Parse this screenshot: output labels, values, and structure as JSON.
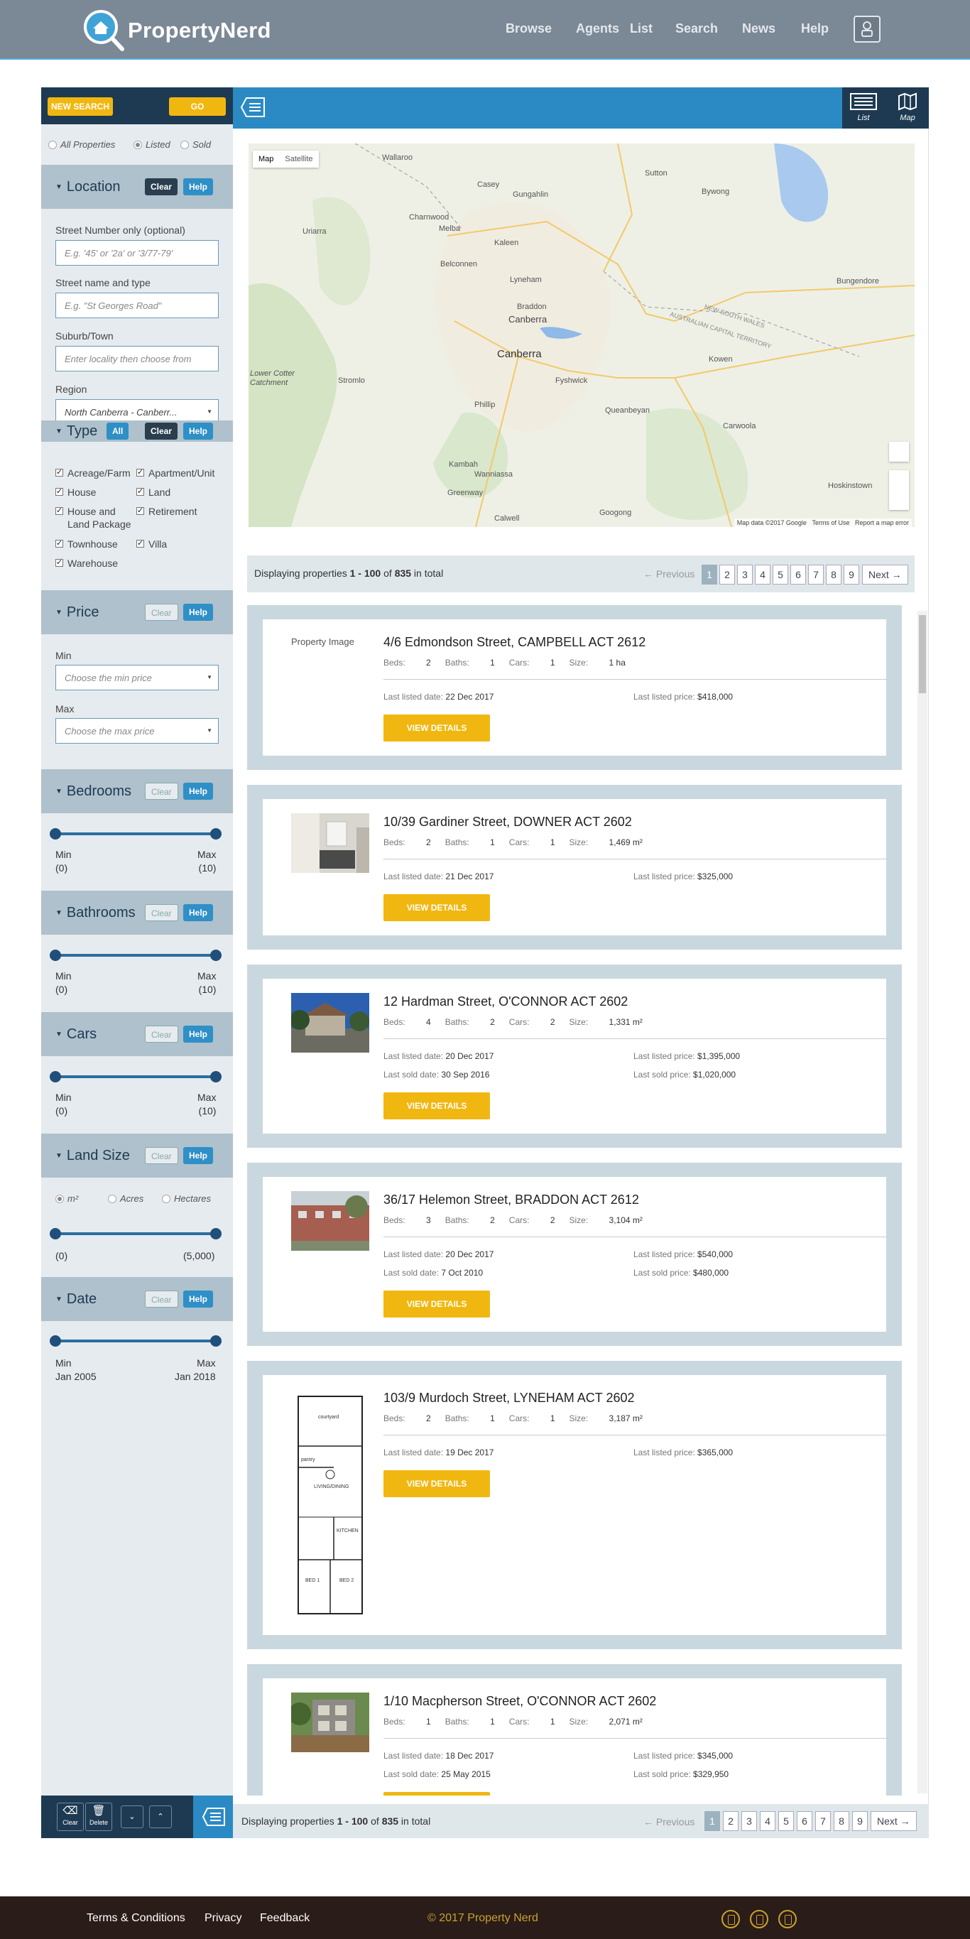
{
  "header": {
    "brand": "PropertyNerd",
    "nav": [
      "Browse",
      "Agents",
      "List",
      "Search",
      "News",
      "Help"
    ]
  },
  "sidebar": {
    "new_search": "NEW SEARCH",
    "go": "GO",
    "status_options": [
      "All Properties",
      "Listed",
      "Sold"
    ],
    "status_selected": "Listed",
    "location": {
      "title": "Location",
      "clear": "Clear",
      "help": "Help",
      "street_number_label": "Street Number only (optional)",
      "street_number_placeholder": "E.g. '45' or '2a' or '3/77-79'",
      "street_name_label": "Street name and type",
      "street_name_placeholder": "E.g. \"St Georges Road\"",
      "suburb_label": "Suburb/Town",
      "suburb_placeholder": "Enter locality then choose from",
      "region_label": "Region",
      "region_value": "North Canberra - Canberr..."
    },
    "type": {
      "title": "Type",
      "all": "All",
      "clear": "Clear",
      "help": "Help",
      "items": [
        "Acreage/Farm",
        "Apartment/Unit",
        "House",
        "Land",
        "House and Land Package",
        "Retirement",
        "Townhouse",
        "Villa",
        "Warehouse"
      ]
    },
    "price": {
      "title": "Price",
      "clear": "Clear",
      "help": "Help",
      "min_label": "Min",
      "min_placeholder": "Choose the min price",
      "max_label": "Max",
      "max_placeholder": "Choose the max price"
    },
    "bedrooms": {
      "title": "Bedrooms",
      "clear": "Clear",
      "help": "Help",
      "min_label": "Min",
      "max_label": "Max",
      "min": "(0)",
      "max": "(10)"
    },
    "bathrooms": {
      "title": "Bathrooms",
      "clear": "Clear",
      "help": "Help",
      "min_label": "Min",
      "max_label": "Max",
      "min": "(0)",
      "max": "(10)"
    },
    "cars": {
      "title": "Cars",
      "clear": "Clear",
      "help": "Help",
      "min_label": "Min",
      "max_label": "Max",
      "min": "(0)",
      "max": "(10)"
    },
    "land_size": {
      "title": "Land Size",
      "clear": "Clear",
      "help": "Help",
      "units": [
        "m²",
        "Acres",
        "Hectares"
      ],
      "min": "(0)",
      "max": "(5,000)"
    },
    "date": {
      "title": "Date",
      "clear": "Clear",
      "help": "Help",
      "min_label": "Min",
      "max_label": "Max",
      "min": "Jan 2005",
      "max": "Jan 2018"
    },
    "bottom": {
      "clear": "Clear",
      "delete": "Delete"
    }
  },
  "toolbar": {
    "list": "List",
    "map": "Map"
  },
  "map": {
    "tabs": [
      "Map",
      "Satellite"
    ],
    "labels": [
      {
        "text": "Wallaroo"
      },
      {
        "text": "Sutton"
      },
      {
        "text": "Casey"
      },
      {
        "text": "Gungahlin"
      },
      {
        "text": "Bywong"
      },
      {
        "text": "Uriarra"
      },
      {
        "text": "Charnwood"
      },
      {
        "text": "Melba"
      },
      {
        "text": "Kaleen"
      },
      {
        "text": "Belconnen"
      },
      {
        "text": "Lyneham"
      },
      {
        "text": "Braddon"
      },
      {
        "text": "Canberra"
      },
      {
        "text": "Bungendore"
      },
      {
        "text": "Canberra"
      },
      {
        "text": "Fyshwick"
      },
      {
        "text": "Kowen"
      },
      {
        "text": "Lower Cotter Catchment"
      },
      {
        "text": "Stromlo"
      },
      {
        "text": "Phillip"
      },
      {
        "text": "Queanbeyan"
      },
      {
        "text": "Carwoola"
      },
      {
        "text": "Kambah"
      },
      {
        "text": "Wanniassa"
      },
      {
        "text": "Greenway"
      },
      {
        "text": "Hoskinstown"
      },
      {
        "text": "Calwell"
      },
      {
        "text": "Googong"
      },
      {
        "text": "NEW SOUTH WALES"
      },
      {
        "text": "AUSTRALIAN CAPITAL TERRITORY"
      }
    ],
    "footer": [
      "Map data ©2017 Google",
      "Terms of Use",
      "Report a map error"
    ]
  },
  "pagination": {
    "summary_prefix": "Displaying properties ",
    "range": "1 - 100",
    "of": " of ",
    "total": "835",
    "suffix": " in total",
    "previous": "← Previous",
    "next": "Next →",
    "pages": [
      "1",
      "2",
      "3",
      "4",
      "5",
      "6",
      "7",
      "8",
      "9"
    ],
    "current": "1"
  },
  "listings": [
    {
      "image_label": "Property Image",
      "title": "4/6 Edmondson Street, CAMPBELL ACT 2612",
      "beds": "2",
      "baths": "1",
      "cars": "1",
      "size": "1 ha",
      "listed_date": "22 Dec 2017",
      "listed_price": "$418,000",
      "sold_date": "",
      "sold_price": ""
    },
    {
      "title": "10/39 Gardiner Street, DOWNER ACT 2602",
      "beds": "2",
      "baths": "1",
      "cars": "1",
      "size": "1,469 m²",
      "listed_date": "21 Dec 2017",
      "listed_price": "$325,000",
      "sold_date": "",
      "sold_price": ""
    },
    {
      "title": "12 Hardman Street, O'CONNOR ACT 2602",
      "beds": "4",
      "baths": "2",
      "cars": "2",
      "size": "1,331 m²",
      "listed_date": "20 Dec 2017",
      "listed_price": "$1,395,000",
      "sold_date": "30 Sep 2016",
      "sold_price": "$1,020,000"
    },
    {
      "title": "36/17 Helemon Street, BRADDON ACT 2612",
      "beds": "3",
      "baths": "2",
      "cars": "2",
      "size": "3,104 m²",
      "listed_date": "20 Dec 2017",
      "listed_price": "$540,000",
      "sold_date": "7 Oct 2010",
      "sold_price": "$480,000"
    },
    {
      "title": "103/9 Murdoch Street, LYNEHAM ACT 2602",
      "beds": "2",
      "baths": "1",
      "cars": "1",
      "size": "3,187 m²",
      "listed_date": "19 Dec 2017",
      "listed_price": "$365,000",
      "sold_date": "",
      "sold_price": ""
    },
    {
      "title": "1/10 Macpherson Street, O'CONNOR ACT 2602",
      "beds": "1",
      "baths": "1",
      "cars": "1",
      "size": "2,071 m²",
      "listed_date": "18 Dec 2017",
      "listed_price": "$345,000",
      "sold_date": "25 May 2015",
      "sold_price": "$329,950"
    }
  ],
  "labels": {
    "beds": "Beds: ",
    "baths": "Baths: ",
    "cars": "Cars: ",
    "size": "Size: ",
    "listed_date": "Last listed date: ",
    "listed_price": "Last listed price: ",
    "sold_date": "Last sold date: ",
    "sold_price": "Last sold price: ",
    "view": "VIEW DETAILS"
  },
  "floorplan_text": [
    "courtyard",
    "pantry",
    "LIVING/DINING",
    "KITCHEN",
    "BED 1",
    "BED 2"
  ],
  "footer": {
    "links": [
      "Terms & Conditions",
      "Privacy",
      "Feedback"
    ],
    "copyright": "© 2017 Property Nerd"
  },
  "colors": {
    "accent": "#2b8ac3",
    "yellow": "#f1b711",
    "navy": "#1e3a52",
    "header": "#7b8896",
    "footer": "#2a1c19"
  }
}
